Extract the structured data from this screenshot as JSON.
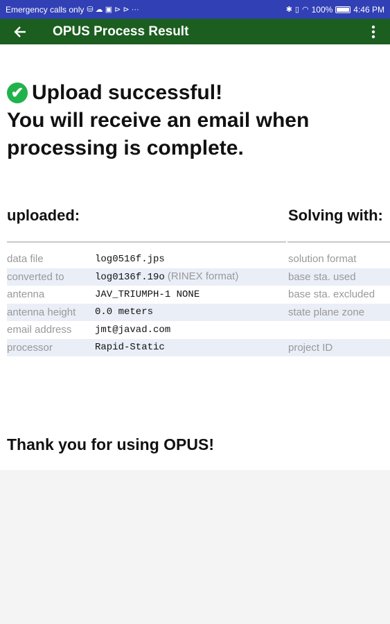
{
  "status_bar": {
    "carrier_text": "Emergency calls only",
    "battery": "100%",
    "time": "4:46 PM"
  },
  "app_bar": {
    "title": "OPUS Process Result"
  },
  "message": {
    "line1": "Upload successful!",
    "line2": "You will receive an email when processing is complete."
  },
  "sections": {
    "left_title": "uploaded:",
    "right_title": "Solving with:"
  },
  "rows": [
    {
      "label": "data file",
      "value": "log0516f.jps",
      "note": "",
      "right_label": "solution format"
    },
    {
      "label": "converted to",
      "value": "log0136f.19o",
      "note": "(RINEX format)",
      "right_label": "base sta. used"
    },
    {
      "label": "antenna",
      "value": "JAV_TRIUMPH-1 NONE",
      "note": "",
      "right_label": "base sta. excluded"
    },
    {
      "label": "antenna height",
      "value": "0.0 meters",
      "note": "",
      "right_label": "state plane zone"
    },
    {
      "label": "email address",
      "value": "jmt@javad.com",
      "note": "",
      "right_label": ""
    },
    {
      "label": "processor",
      "value": "Rapid-Static",
      "note": "",
      "right_label": "project ID"
    }
  ],
  "footer": {
    "thanks": "Thank you for using OPUS!"
  },
  "colors": {
    "status_bar": "#3140b5",
    "app_bar": "#1b5e20",
    "check": "#22b24c",
    "row_alt": "#e9eef7"
  },
  "icons": [
    "wifi-icon",
    "bluetooth-icon",
    "battery-icon",
    "back-arrow-icon",
    "overflow-menu-icon",
    "check-circle-icon"
  ]
}
